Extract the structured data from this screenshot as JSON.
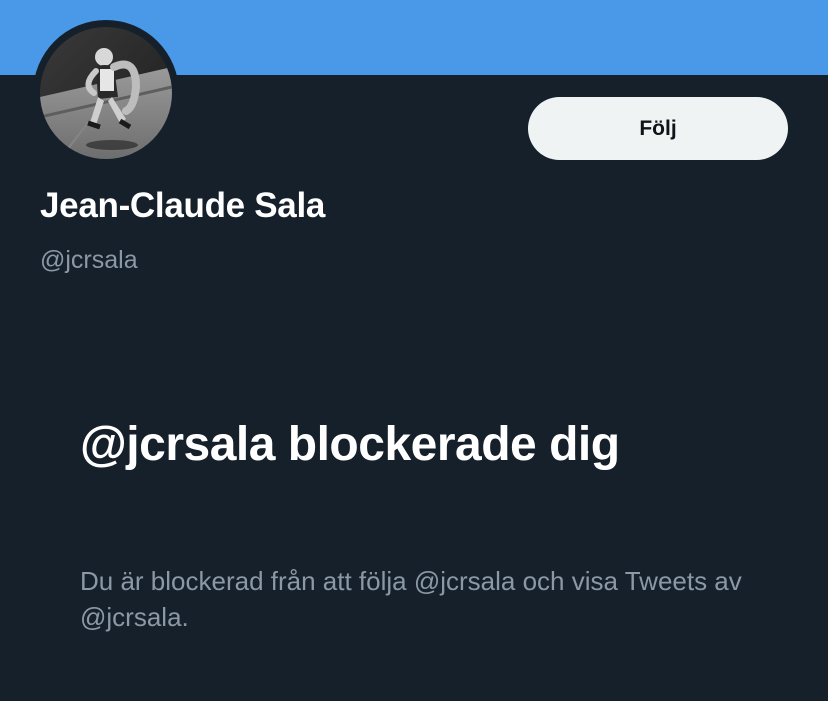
{
  "header": {
    "banner_color": "#4A99E9"
  },
  "profile": {
    "display_name": "Jean-Claude Sala",
    "handle": "@jcrsala",
    "avatar_icon": "profile-photo"
  },
  "actions": {
    "follow_label": "Följ"
  },
  "blocked": {
    "title": "@jcrsala blockerade dig",
    "description": "Du är blockerad från att följa @jcrsala och visa Tweets av @jcrsala."
  },
  "colors": {
    "background": "#15202B",
    "secondary_text": "#8B98A5",
    "button_bg": "#EFF3F4"
  }
}
